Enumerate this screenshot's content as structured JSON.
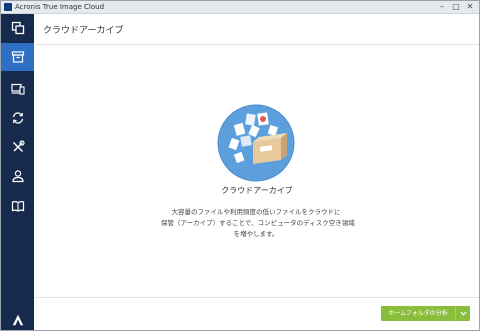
{
  "window": {
    "title": "Acronis True Image Cloud",
    "controls": {
      "minimize": "–",
      "maximize": "□",
      "close": "✕"
    }
  },
  "sidebar": {
    "items": [
      {
        "name": "backup",
        "icon": "copy-icon",
        "active": false
      },
      {
        "name": "archive",
        "icon": "archive-box-icon",
        "active": true
      },
      {
        "name": "devices",
        "icon": "devices-icon",
        "active": false
      },
      {
        "name": "sync",
        "icon": "sync-icon",
        "active": false
      },
      {
        "name": "tools",
        "icon": "tools-icon",
        "active": false
      },
      {
        "name": "account",
        "icon": "user-icon",
        "active": false
      },
      {
        "name": "help",
        "icon": "book-icon",
        "active": false
      }
    ],
    "logo": "acronis-logo"
  },
  "header": {
    "title": "クラウドアーカイブ"
  },
  "main": {
    "heading": "クラウドアーカイブ",
    "description_lines": [
      "大容量のファイルや利用頻度の低いファイルをクラウドに",
      "保管（アーカイブ）することで、コンピュータのディスク空き領域",
      "を増やします。"
    ]
  },
  "footer": {
    "analyze_button": "ホームフォルダの分析"
  },
  "colors": {
    "sidebar": "#152a4c",
    "active_nav": "#2c6fc3",
    "accent_green": "#8bbd3c",
    "illustration_circle": "#5d9fdc"
  }
}
